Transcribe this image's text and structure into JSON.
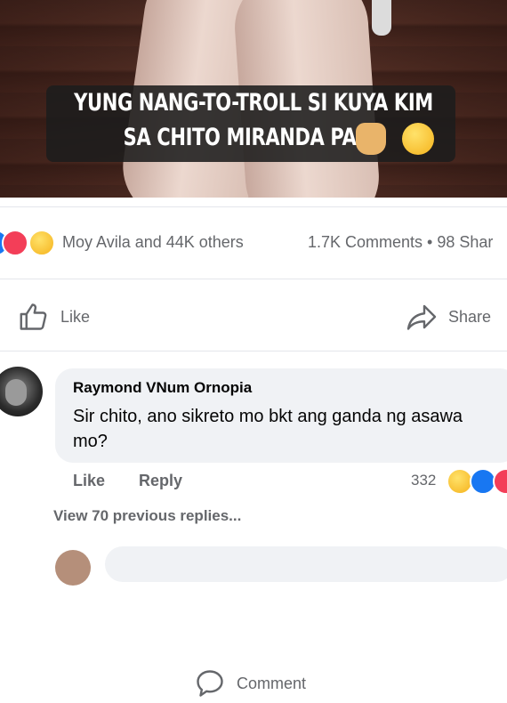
{
  "post": {
    "caption_line1": "YUNG NANG-TO-TROLL SI KUYA KIM",
    "caption_line2": "SA CHITO MIRANDA PAGE"
  },
  "reactions": {
    "names": "Moy Avila and 44K others",
    "stats": "1.7K Comments • 98 Shar",
    "icons": [
      "like-reaction-icon",
      "love-reaction-icon",
      "haha-reaction-icon"
    ]
  },
  "actions": {
    "like": "Like",
    "comment": "Comment",
    "share": "Share"
  },
  "comment": {
    "author": "Raymond VNum Ornopia",
    "text": "Sir chito, ano sikreto mo bkt ang ganda ng asawa mo?",
    "like": "Like",
    "reply": "Reply",
    "reaction_count": "332"
  },
  "view_replies": "View 70 previous replies...",
  "colors": {
    "accent": "#1877f2",
    "love": "#f33e58",
    "secondary_text": "#65676b",
    "bubble": "#f0f2f5"
  }
}
